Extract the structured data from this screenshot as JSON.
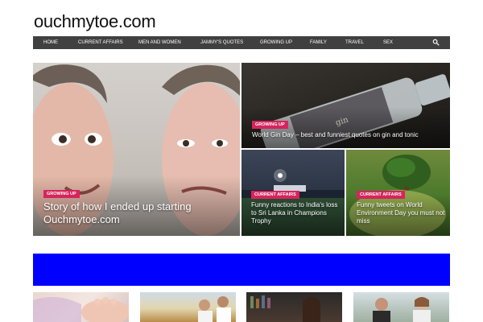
{
  "site": {
    "logo": "ouchmytoe.com"
  },
  "nav": {
    "items": [
      "HOME",
      "CURRENT AFFAIRS",
      "MEN AND WOMEN",
      "JAMMY'S QUOTES",
      "GROWING UP",
      "FAMILY",
      "TRAVEL",
      "SEX"
    ],
    "search_icon": "search-icon"
  },
  "featured": [
    {
      "tag": "GROWING UP",
      "title": "Story of how I ended up starting Ouchmytoe.com"
    },
    {
      "tag": "GROWING UP",
      "title": "World Gin Day – best and funniest quotes on gin and tonic"
    },
    {
      "tag": "CURRENT AFFAIRS",
      "title": "Funny reactions to India's loss to Sri Lanka in Champions Trophy"
    },
    {
      "tag": "CURRENT AFFAIRS",
      "title": "Funny tweets on World Environment Day you must not miss"
    }
  ],
  "colors": {
    "nav_bg": "#404040",
    "tag_bg": "#d6245d",
    "ad_bg": "#0000ff"
  }
}
